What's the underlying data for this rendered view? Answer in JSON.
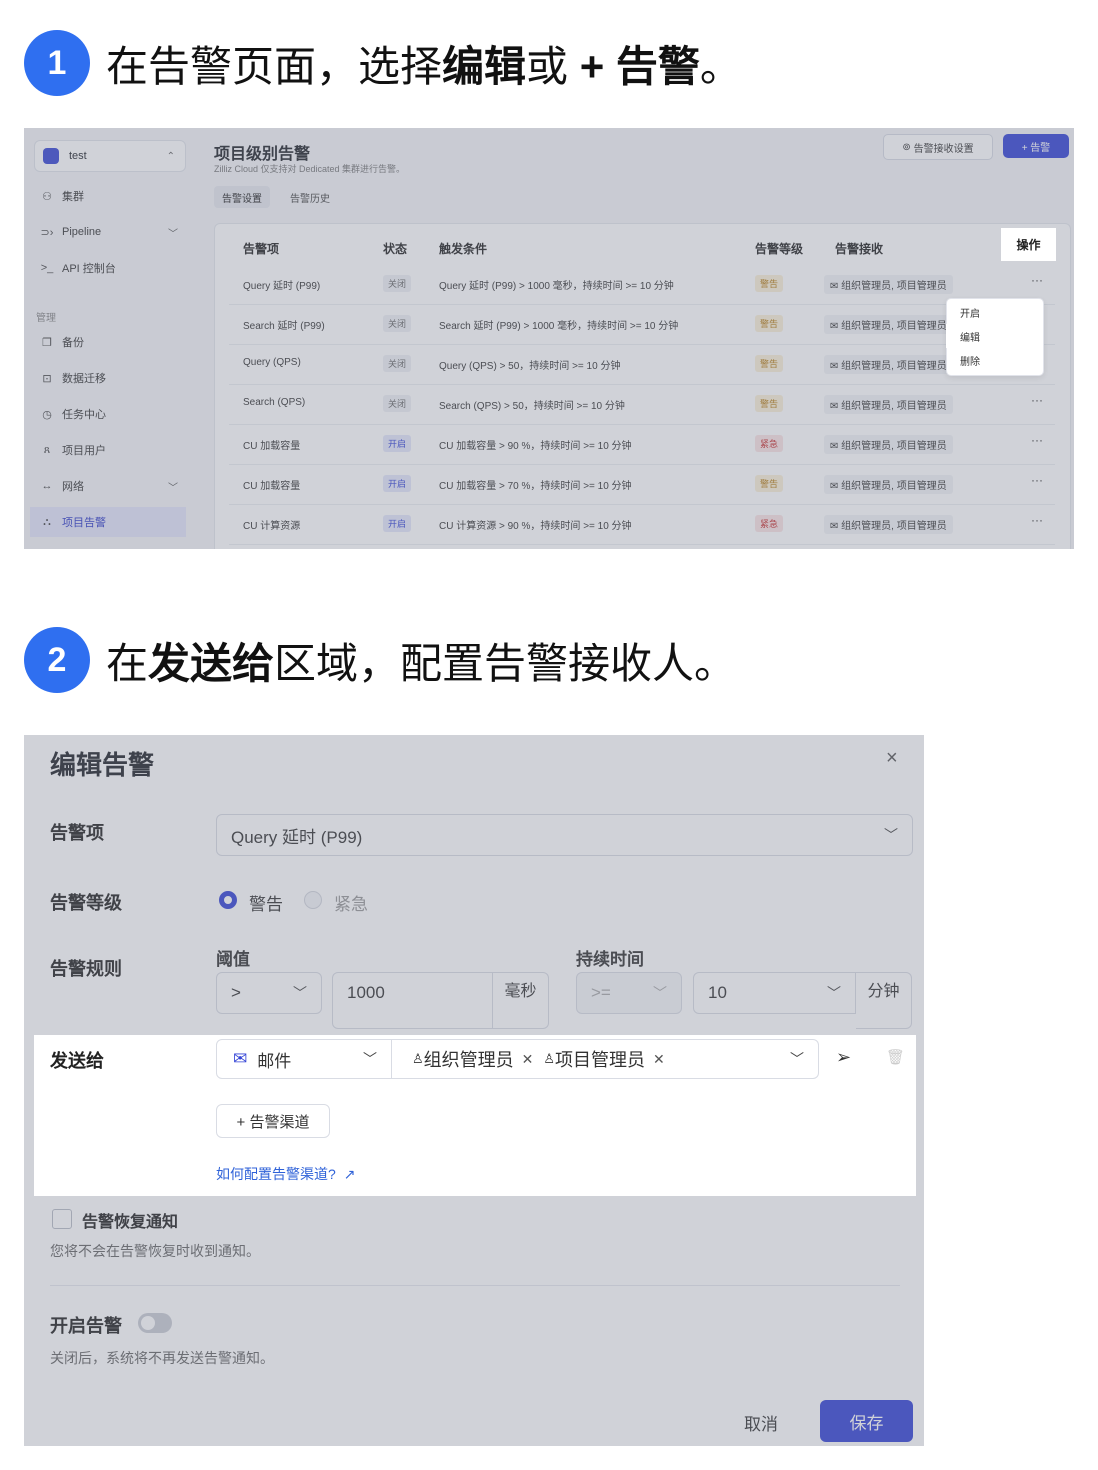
{
  "step1": {
    "number": "1",
    "text_a": "在告警页面，选择",
    "bold_a": "编辑",
    "text_b": "或",
    "bold_b": "+ 告警",
    "text_c": "。"
  },
  "step2": {
    "number": "2",
    "text_a": "在",
    "bold_a": "发送给",
    "text_b": "区域，配置告警接收人。"
  },
  "shot1": {
    "project": "test",
    "nav": [
      {
        "icon": "cluster-icon",
        "label": "集群"
      },
      {
        "icon": "pipeline-icon",
        "label": "Pipeline"
      },
      {
        "icon": "terminal-icon",
        "label": "API 控制台"
      },
      {
        "icon": "backup-icon",
        "label": "备份"
      },
      {
        "icon": "migration-icon",
        "label": "数据迁移"
      },
      {
        "icon": "clock-icon",
        "label": "任务中心"
      },
      {
        "icon": "users-icon",
        "label": "项目用户"
      },
      {
        "icon": "network-icon",
        "label": "网络"
      },
      {
        "icon": "alarm-icon",
        "label": "项目告警"
      }
    ],
    "section_manage": "管理",
    "page_title": "项目级别告警",
    "page_subtitle": "Zilliz Cloud 仅支持对 Dedicated 集群进行告警。",
    "btn_receive_settings": "告警接收设置",
    "btn_add_alert": "+ 告警",
    "tabs": [
      "告警设置",
      "告警历史"
    ],
    "columns": [
      "告警项",
      "状态",
      "触发条件",
      "告警等级",
      "告警接收",
      "操作"
    ],
    "rows": [
      {
        "item": "Query 延时 (P99)",
        "status": "关闭",
        "condition": "Query 延时 (P99) > 1000 毫秒，持续时间 >= 10 分钟",
        "level": "警告",
        "receiver": "组织管理员, 项目管理员"
      },
      {
        "item": "Search 延时 (P99)",
        "status": "关闭",
        "condition": "Search 延时 (P99) > 1000 毫秒，持续时间 >= 10 分钟",
        "level": "警告",
        "receiver": "组织管理员, 项目管理员"
      },
      {
        "item": "Query (QPS)",
        "status": "关闭",
        "condition": "Query (QPS) > 50，持续时间 >= 10 分钟",
        "level": "警告",
        "receiver": "组织管理员, 项目管理员"
      },
      {
        "item": "Search (QPS)",
        "status": "关闭",
        "condition": "Search (QPS) > 50，持续时间 >= 10 分钟",
        "level": "警告",
        "receiver": "组织管理员, 项目管理员"
      },
      {
        "item": "CU 加载容量",
        "status": "开启",
        "condition": "CU 加载容量 > 90 %，持续时间 >= 10 分钟",
        "level": "紧急",
        "receiver": "组织管理员, 项目管理员"
      },
      {
        "item": "CU 加载容量",
        "status": "开启",
        "condition": "CU 加载容量 > 70 %，持续时间 >= 10 分钟",
        "level": "警告",
        "receiver": "组织管理员, 项目管理员"
      },
      {
        "item": "CU 计算资源",
        "status": "开启",
        "condition": "CU 计算资源 > 90 %，持续时间 >= 10 分钟",
        "level": "紧急",
        "receiver": "组织管理员, 项目管理员"
      }
    ],
    "more": "···",
    "menu": [
      "开启",
      "编辑",
      "删除"
    ]
  },
  "shot2": {
    "title": "编辑告警",
    "close": "×",
    "label_item": "告警项",
    "item_value": "Query 延时 (P99)",
    "label_level": "告警等级",
    "level_warn": "警告",
    "level_crit": "紧急",
    "label_rule": "告警规则",
    "threshold_label": "阈值",
    "threshold_op": ">",
    "threshold_value": "1000",
    "threshold_unit": "毫秒",
    "duration_label": "持续时间",
    "duration_op": ">=",
    "duration_value": "10",
    "duration_unit": "分钟",
    "label_send": "发送给",
    "channel": "邮件",
    "recipients": [
      "组织管理员",
      "项目管理员"
    ],
    "add_channel": "+ 告警渠道",
    "help_link": "如何配置告警渠道?",
    "recovery_label": "告警恢复通知",
    "recovery_desc": "您将不会在告警恢复时收到通知。",
    "enable_label": "开启告警",
    "enable_desc": "关闭后，系统将不再发送告警通知。",
    "cancel": "取消",
    "save": "保存"
  }
}
